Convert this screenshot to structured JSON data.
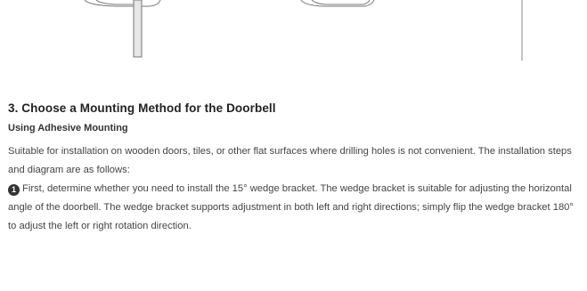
{
  "section": {
    "title": "3. Choose a Mounting Method for the Doorbell",
    "subtitle": "Using Adhesive Mounting"
  },
  "intro": "Suitable for installation on wooden doors, tiles, or other flat surfaces where drilling holes is not convenient. The installation steps and diagram are as follows:",
  "steps": [
    {
      "number": "1",
      "text": "First, determine whether you need to install the 15° wedge bracket. The wedge bracket is suitable for adjusting the horizontal angle of the doorbell. The wedge bracket supports adjustment in both left and right directions; simply flip the wedge bracket 180° to adjust the left or right rotation direction."
    }
  ]
}
